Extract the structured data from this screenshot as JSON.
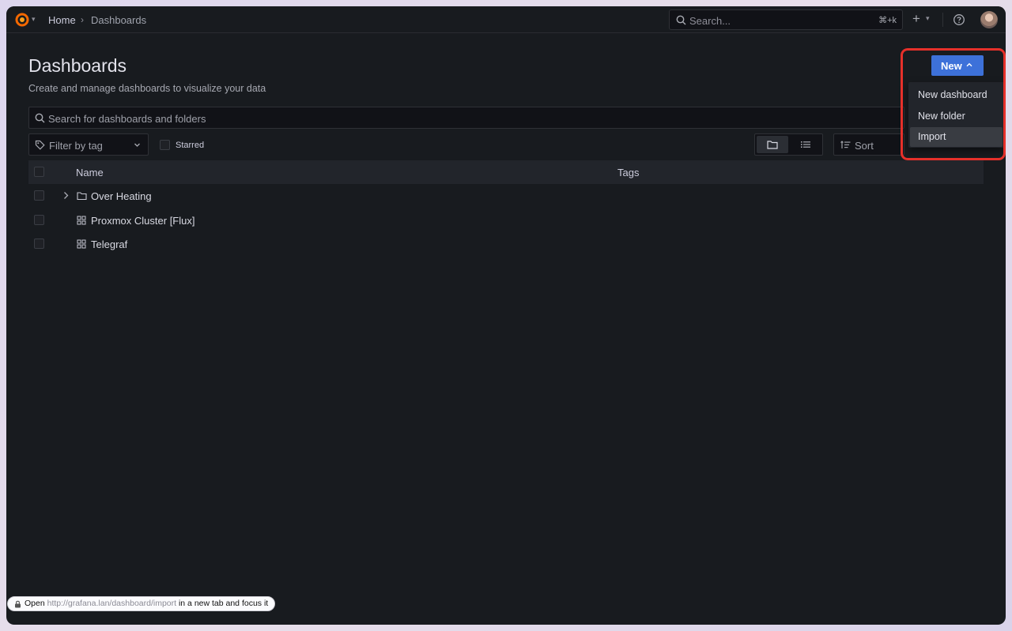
{
  "breadcrumb": {
    "home": "Home",
    "separator": "›",
    "current": "Dashboards"
  },
  "top_search": {
    "placeholder": "Search...",
    "shortcut": "⌘+k"
  },
  "topbar_icons": [
    "grafana-logo-icon",
    "plus-icon",
    "help-icon",
    "avatar"
  ],
  "page": {
    "title": "Dashboards",
    "subtitle": "Create and manage dashboards to visualize your data"
  },
  "search": {
    "placeholder": "Search for dashboards and folders"
  },
  "filters": {
    "tag_placeholder": "Filter by tag",
    "starred_label": "Starred",
    "starred_checked": false,
    "view_mode": "folder",
    "sort_placeholder": "Sort"
  },
  "table": {
    "columns": [
      "Name",
      "Tags"
    ],
    "rows": [
      {
        "name": "Over Heating",
        "type": "folder",
        "icon": "folder-icon",
        "expandable": true
      },
      {
        "name": "Proxmox Cluster [Flux]",
        "type": "dashboard",
        "icon": "dashboard-grid-icon",
        "expandable": false
      },
      {
        "name": "Telegraf",
        "type": "dashboard",
        "icon": "dashboard-grid-icon",
        "expandable": false
      }
    ]
  },
  "new_button": {
    "label": "New",
    "expanded": true,
    "color": "#3d71d9"
  },
  "new_menu": {
    "items": [
      "New dashboard",
      "New folder",
      "Import"
    ],
    "hovered": "Import"
  },
  "annotation": {
    "highlight_color": "#e6302a"
  },
  "status_bar": {
    "prefix": "Open",
    "url": "http://grafana.lan/dashboard/import",
    "suffix": "in a new tab and focus it"
  }
}
